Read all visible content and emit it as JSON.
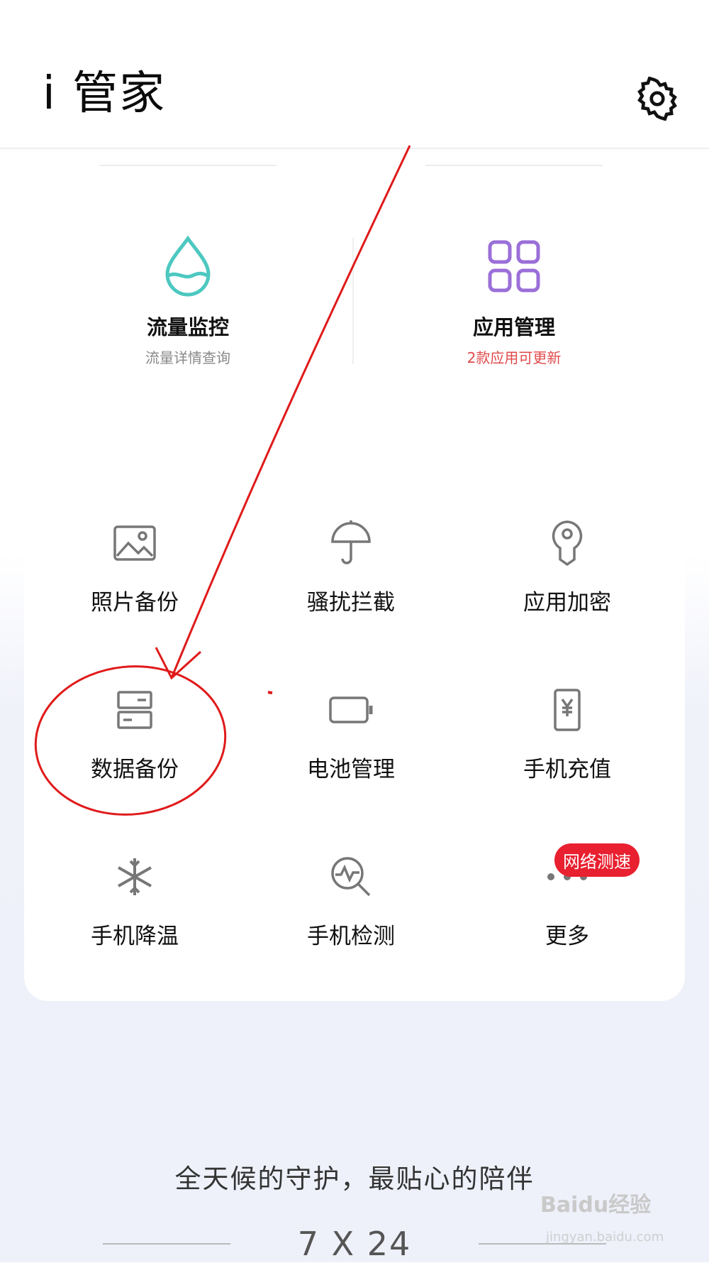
{
  "header": {
    "title": "i 管家",
    "settings_icon": "gear-icon"
  },
  "features": [
    {
      "name": "流量监控",
      "sub": "流量详情查询",
      "icon": "water-drop-icon",
      "color": "#4cc8c0"
    },
    {
      "name": "应用管理",
      "sub": "2款应用可更新",
      "icon": "app-grid-icon",
      "color": "#9b6fd8",
      "sub_color": "#e04a4a"
    }
  ],
  "tools": [
    {
      "label": "照片备份",
      "icon": "image-icon"
    },
    {
      "label": "骚扰拦截",
      "icon": "umbrella-icon"
    },
    {
      "label": "应用加密",
      "icon": "key-lock-icon"
    },
    {
      "label": "数据备份",
      "icon": "storage-icon"
    },
    {
      "label": "电池管理",
      "icon": "battery-icon"
    },
    {
      "label": "手机充值",
      "icon": "phone-yuan-icon"
    },
    {
      "label": "手机降温",
      "icon": "snowflake-icon"
    },
    {
      "label": "手机检测",
      "icon": "magnifier-pulse-icon"
    },
    {
      "label": "更多",
      "icon": "more-dots-icon",
      "badge": "网络测速"
    }
  ],
  "footer": {
    "slogan": "全天候的守护，最贴心的陪伴",
    "hours": "7 X 24"
  },
  "watermark": {
    "brand": "Baidu经验",
    "url": "jingyan.baidu.com"
  },
  "colors": {
    "annotation": "#e01a1a",
    "badge": "#e8202f",
    "icon_gray": "#777777"
  }
}
